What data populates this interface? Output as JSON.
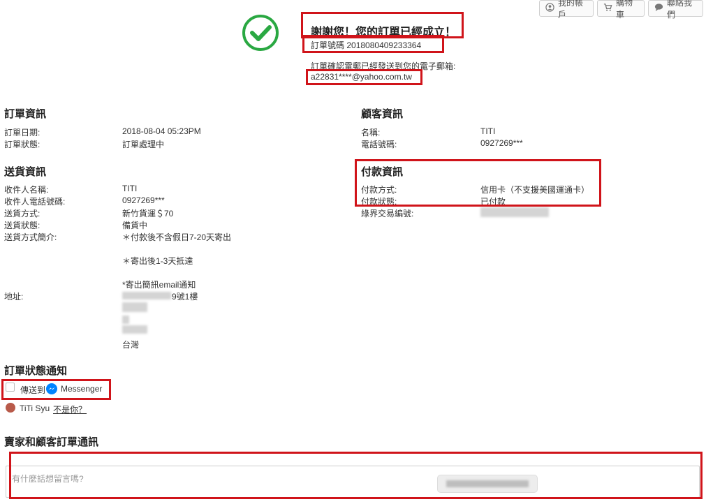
{
  "header_buttons": {
    "account": "我的帳戶",
    "cart": "購物車",
    "contact": "聯絡我們"
  },
  "confirmation": {
    "title": "謝謝您！您的訂單已經成立！",
    "order_number_label": "訂單號碼",
    "order_number": "2018080409233364",
    "email_note": "訂單確認電郵已經發送到您的電子郵箱:",
    "email": "a22831****@yahoo.com.tw"
  },
  "order_info": {
    "heading": "訂單資訊",
    "date_label": "訂單日期:",
    "date_value": "2018-08-04 05:23PM",
    "status_label": "訂單狀態:",
    "status_value": "訂單處理中"
  },
  "customer_info": {
    "heading": "顧客資訊",
    "name_label": "名稱:",
    "name_value": "TITI",
    "phone_label": "電話號碼:",
    "phone_value": "0927269***"
  },
  "delivery_info": {
    "heading": "送貨資訊",
    "recipient_label": "收件人名稱:",
    "recipient_value": "TITI",
    "recipient_phone_label": "收件人電話號碼:",
    "recipient_phone_value": "0927269***",
    "method_label": "送貨方式:",
    "method_value": "新竹貨運＄70",
    "status_label": "送貨狀態:",
    "status_value": "備貨中",
    "desc_label": "送貨方式簡介:",
    "desc_line1": "＊付款後不含假日7-20天寄出",
    "desc_line2": "＊寄出後1-3天抵達",
    "desc_line3": "*寄出簡訊email通知",
    "address_label": "地址:",
    "address_partial": "9號1樓",
    "address_country": "台灣"
  },
  "payment_info": {
    "heading": "付款資訊",
    "method_label": "付款方式:",
    "method_value": "信用卡（不支援美國運通卡）",
    "status_label": "付款狀態:",
    "status_value": "已付款",
    "txn_label": "綠界交易編號:"
  },
  "notification": {
    "heading": "訂單狀態通知",
    "send_to": "傳送到",
    "messenger": "Messenger",
    "user_name": "TiTi Syu",
    "not_you": "不是你？"
  },
  "communication": {
    "heading": "賣家和顧客訂單通訊",
    "placeholder": "有什麼話想留言嗎?"
  },
  "colors": {
    "success_green": "#2aa842",
    "highlight_red": "#d0141a",
    "messenger_blue": "#0084ff"
  }
}
